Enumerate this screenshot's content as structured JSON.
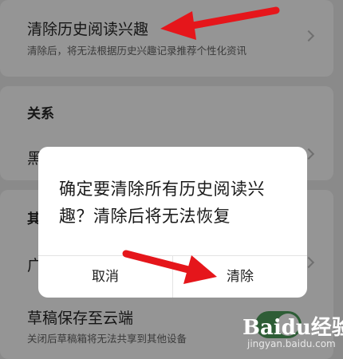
{
  "settings": {
    "clear_history": {
      "title": "清除历史阅读兴趣",
      "description": "清除后，将无法根据历史兴趣记录推荐个性化资讯"
    },
    "relations_section": {
      "title": "关系"
    },
    "blacklist_item": {
      "title": "黑"
    },
    "other_section": {
      "title": "其"
    },
    "ad_item": {
      "title": "广"
    },
    "draft_cloud": {
      "title": "草稿保存至云端",
      "description": "关闭后草稿箱将无法共享到其他设备",
      "toggle_on": true
    }
  },
  "dialog": {
    "message": "确定要清除所有历史阅读兴趣？清除后将无法恢复",
    "cancel_label": "取消",
    "confirm_label": "清除"
  },
  "watermark": {
    "logo": "Baidu经验",
    "url": "jingyan.baidu.com"
  },
  "colors": {
    "overlay_dim": "#8a8a8a",
    "dialog_bg": "#ffffff",
    "arrow": "#e5161b",
    "toggle_on": "#2e5d36"
  }
}
